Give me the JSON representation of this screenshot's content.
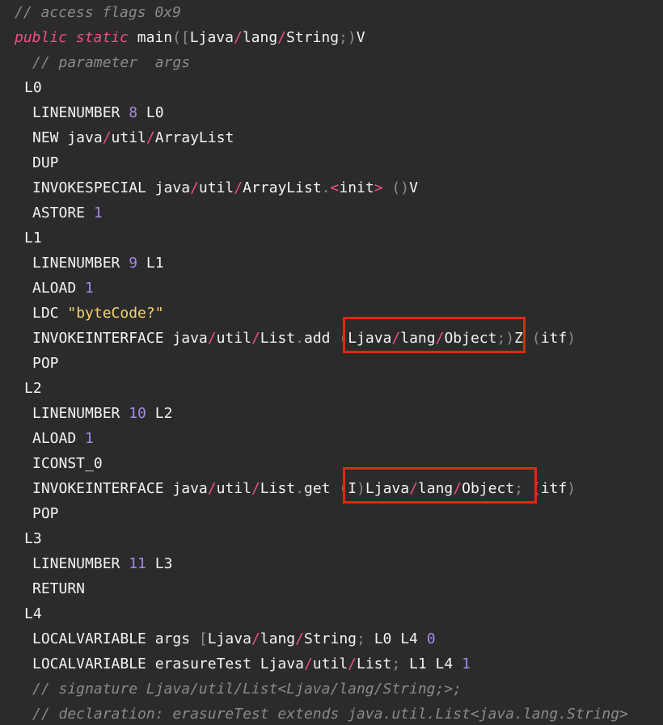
{
  "lines": [
    {
      "indent": 18,
      "tokens": [
        {
          "t": "// access flags 0x9",
          "k": "comment"
        }
      ]
    },
    {
      "indent": 18,
      "tokens": [
        {
          "t": "public",
          "k": "keyword"
        },
        {
          "t": " ",
          "k": "plain"
        },
        {
          "t": "static",
          "k": "keyword"
        },
        {
          "t": " main",
          "k": "plain"
        },
        {
          "t": "([",
          "k": "punct"
        },
        {
          "t": "Ljava",
          "k": "plain"
        },
        {
          "t": "/",
          "k": "slash"
        },
        {
          "t": "lang",
          "k": "plain"
        },
        {
          "t": "/",
          "k": "slash"
        },
        {
          "t": "String",
          "k": "plain"
        },
        {
          "t": ";)",
          "k": "punct"
        },
        {
          "t": "V",
          "k": "plain"
        }
      ]
    },
    {
      "indent": 40,
      "tokens": [
        {
          "t": "// parameter  args",
          "k": "comment"
        }
      ]
    },
    {
      "indent": 30,
      "tokens": [
        {
          "t": "L0",
          "k": "plain"
        }
      ]
    },
    {
      "indent": 40,
      "tokens": [
        {
          "t": "LINENUMBER ",
          "k": "plain"
        },
        {
          "t": "8",
          "k": "number"
        },
        {
          "t": " L0",
          "k": "plain"
        }
      ]
    },
    {
      "indent": 40,
      "tokens": [
        {
          "t": "NEW java",
          "k": "plain"
        },
        {
          "t": "/",
          "k": "slash"
        },
        {
          "t": "util",
          "k": "plain"
        },
        {
          "t": "/",
          "k": "slash"
        },
        {
          "t": "ArrayList",
          "k": "plain"
        }
      ]
    },
    {
      "indent": 40,
      "tokens": [
        {
          "t": "DUP",
          "k": "plain"
        }
      ]
    },
    {
      "indent": 40,
      "tokens": [
        {
          "t": "INVOKESPECIAL java",
          "k": "plain"
        },
        {
          "t": "/",
          "k": "slash"
        },
        {
          "t": "util",
          "k": "plain"
        },
        {
          "t": "/",
          "k": "slash"
        },
        {
          "t": "ArrayList",
          "k": "plain"
        },
        {
          "t": ".",
          "k": "punct"
        },
        {
          "t": "<",
          "k": "slash"
        },
        {
          "t": "init",
          "k": "plain"
        },
        {
          "t": ">",
          "k": "slash"
        },
        {
          "t": " ()",
          "k": "punct"
        },
        {
          "t": "V",
          "k": "plain"
        }
      ]
    },
    {
      "indent": 40,
      "tokens": [
        {
          "t": "ASTORE ",
          "k": "plain"
        },
        {
          "t": "1",
          "k": "number"
        }
      ]
    },
    {
      "indent": 30,
      "tokens": [
        {
          "t": "L1",
          "k": "plain"
        }
      ]
    },
    {
      "indent": 40,
      "tokens": [
        {
          "t": "LINENUMBER ",
          "k": "plain"
        },
        {
          "t": "9",
          "k": "number"
        },
        {
          "t": " L1",
          "k": "plain"
        }
      ]
    },
    {
      "indent": 40,
      "tokens": [
        {
          "t": "ALOAD ",
          "k": "plain"
        },
        {
          "t": "1",
          "k": "number"
        }
      ]
    },
    {
      "indent": 40,
      "tokens": [
        {
          "t": "LDC ",
          "k": "plain"
        },
        {
          "t": "\"byteCode?\"",
          "k": "string"
        }
      ]
    },
    {
      "indent": 40,
      "tokens": [
        {
          "t": "INVOKEINTERFACE java",
          "k": "plain"
        },
        {
          "t": "/",
          "k": "slash"
        },
        {
          "t": "util",
          "k": "plain"
        },
        {
          "t": "/",
          "k": "slash"
        },
        {
          "t": "List",
          "k": "plain"
        },
        {
          "t": ".",
          "k": "punct"
        },
        {
          "t": "add ",
          "k": "plain"
        },
        {
          "t": "(",
          "k": "punct"
        },
        {
          "t": "Ljava",
          "k": "plain"
        },
        {
          "t": "/",
          "k": "slash"
        },
        {
          "t": "lang",
          "k": "plain"
        },
        {
          "t": "/",
          "k": "slash"
        },
        {
          "t": "Object",
          "k": "plain"
        },
        {
          "t": ";)",
          "k": "punct"
        },
        {
          "t": "Z ",
          "k": "plain"
        },
        {
          "t": "(",
          "k": "punct"
        },
        {
          "t": "itf",
          "k": "plain"
        },
        {
          "t": ")",
          "k": "punct"
        }
      ]
    },
    {
      "indent": 40,
      "tokens": [
        {
          "t": "POP",
          "k": "plain"
        }
      ]
    },
    {
      "indent": 30,
      "tokens": [
        {
          "t": "L2",
          "k": "plain"
        }
      ]
    },
    {
      "indent": 40,
      "tokens": [
        {
          "t": "LINENUMBER ",
          "k": "plain"
        },
        {
          "t": "10",
          "k": "number"
        },
        {
          "t": " L2",
          "k": "plain"
        }
      ]
    },
    {
      "indent": 40,
      "tokens": [
        {
          "t": "ALOAD ",
          "k": "plain"
        },
        {
          "t": "1",
          "k": "number"
        }
      ]
    },
    {
      "indent": 40,
      "tokens": [
        {
          "t": "ICONST_0",
          "k": "plain"
        }
      ]
    },
    {
      "indent": 40,
      "tokens": [
        {
          "t": "INVOKEINTERFACE java",
          "k": "plain"
        },
        {
          "t": "/",
          "k": "slash"
        },
        {
          "t": "util",
          "k": "plain"
        },
        {
          "t": "/",
          "k": "slash"
        },
        {
          "t": "List",
          "k": "plain"
        },
        {
          "t": ".",
          "k": "punct"
        },
        {
          "t": "get ",
          "k": "plain"
        },
        {
          "t": "(",
          "k": "punct"
        },
        {
          "t": "I",
          "k": "plain"
        },
        {
          "t": ")",
          "k": "punct"
        },
        {
          "t": "Ljava",
          "k": "plain"
        },
        {
          "t": "/",
          "k": "slash"
        },
        {
          "t": "lang",
          "k": "plain"
        },
        {
          "t": "/",
          "k": "slash"
        },
        {
          "t": "Object",
          "k": "plain"
        },
        {
          "t": "; ",
          "k": "punct"
        },
        {
          "t": "(",
          "k": "punct"
        },
        {
          "t": "itf",
          "k": "plain"
        },
        {
          "t": ")",
          "k": "punct"
        }
      ]
    },
    {
      "indent": 40,
      "tokens": [
        {
          "t": "POP",
          "k": "plain"
        }
      ]
    },
    {
      "indent": 30,
      "tokens": [
        {
          "t": "L3",
          "k": "plain"
        }
      ]
    },
    {
      "indent": 40,
      "tokens": [
        {
          "t": "LINENUMBER ",
          "k": "plain"
        },
        {
          "t": "11",
          "k": "number"
        },
        {
          "t": " L3",
          "k": "plain"
        }
      ]
    },
    {
      "indent": 40,
      "tokens": [
        {
          "t": "RETURN",
          "k": "plain"
        }
      ]
    },
    {
      "indent": 30,
      "tokens": [
        {
          "t": "L4",
          "k": "plain"
        }
      ]
    },
    {
      "indent": 40,
      "tokens": [
        {
          "t": "LOCALVARIABLE args ",
          "k": "plain"
        },
        {
          "t": "[",
          "k": "punct"
        },
        {
          "t": "Ljava",
          "k": "plain"
        },
        {
          "t": "/",
          "k": "slash"
        },
        {
          "t": "lang",
          "k": "plain"
        },
        {
          "t": "/",
          "k": "slash"
        },
        {
          "t": "String",
          "k": "plain"
        },
        {
          "t": ";",
          "k": "punct"
        },
        {
          "t": " L0 L4 ",
          "k": "plain"
        },
        {
          "t": "0",
          "k": "number"
        }
      ]
    },
    {
      "indent": 40,
      "tokens": [
        {
          "t": "LOCALVARIABLE erasureTest Ljava",
          "k": "plain"
        },
        {
          "t": "/",
          "k": "slash"
        },
        {
          "t": "util",
          "k": "plain"
        },
        {
          "t": "/",
          "k": "slash"
        },
        {
          "t": "List",
          "k": "plain"
        },
        {
          "t": ";",
          "k": "punct"
        },
        {
          "t": " L1 L4 ",
          "k": "plain"
        },
        {
          "t": "1",
          "k": "number"
        }
      ]
    },
    {
      "indent": 40,
      "tokens": [
        {
          "t": "// signature Ljava/util/List<Ljava/lang/String;>;",
          "k": "comment"
        }
      ]
    },
    {
      "indent": 40,
      "tokens": [
        {
          "t": "// declaration: erasureTest extends java.util.List<java.lang.String>",
          "k": "comment"
        }
      ]
    }
  ],
  "highlights": [
    {
      "line": 13,
      "label": "add-descriptor"
    },
    {
      "line": 19,
      "label": "get-descriptor"
    }
  ],
  "colors": {
    "background": "#2b2b2b",
    "text": "#f3f3f3",
    "comment": "#8a8a8a",
    "keyword": "#ee4f86",
    "number": "#a48ae6",
    "string": "#f5d36b",
    "highlight_border": "#e02810"
  }
}
